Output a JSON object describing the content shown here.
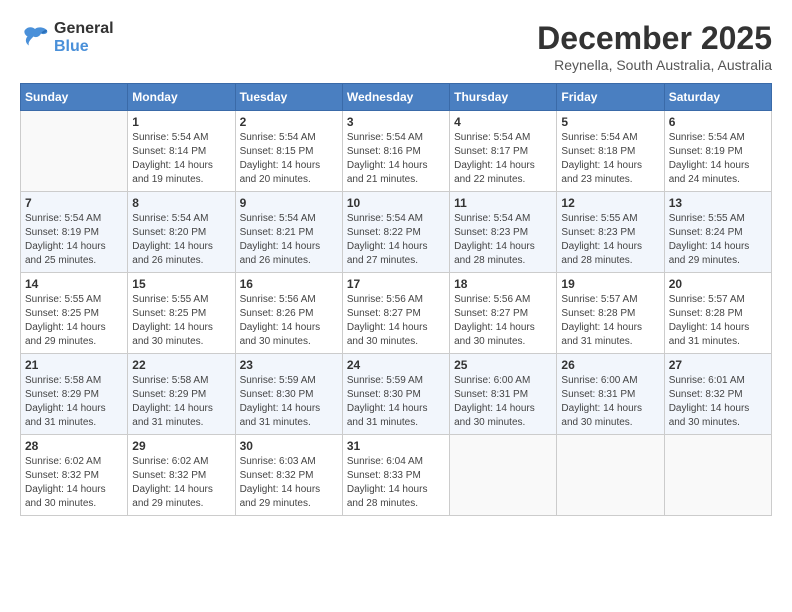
{
  "header": {
    "logo_line1": "General",
    "logo_line2": "Blue",
    "month": "December 2025",
    "location": "Reynella, South Australia, Australia"
  },
  "weekdays": [
    "Sunday",
    "Monday",
    "Tuesday",
    "Wednesday",
    "Thursday",
    "Friday",
    "Saturday"
  ],
  "weeks": [
    [
      {
        "num": "",
        "empty": true
      },
      {
        "num": "1",
        "sunrise": "Sunrise: 5:54 AM",
        "sunset": "Sunset: 8:14 PM",
        "daylight": "Daylight: 14 hours and 19 minutes."
      },
      {
        "num": "2",
        "sunrise": "Sunrise: 5:54 AM",
        "sunset": "Sunset: 8:15 PM",
        "daylight": "Daylight: 14 hours and 20 minutes."
      },
      {
        "num": "3",
        "sunrise": "Sunrise: 5:54 AM",
        "sunset": "Sunset: 8:16 PM",
        "daylight": "Daylight: 14 hours and 21 minutes."
      },
      {
        "num": "4",
        "sunrise": "Sunrise: 5:54 AM",
        "sunset": "Sunset: 8:17 PM",
        "daylight": "Daylight: 14 hours and 22 minutes."
      },
      {
        "num": "5",
        "sunrise": "Sunrise: 5:54 AM",
        "sunset": "Sunset: 8:18 PM",
        "daylight": "Daylight: 14 hours and 23 minutes."
      },
      {
        "num": "6",
        "sunrise": "Sunrise: 5:54 AM",
        "sunset": "Sunset: 8:19 PM",
        "daylight": "Daylight: 14 hours and 24 minutes."
      }
    ],
    [
      {
        "num": "7",
        "sunrise": "Sunrise: 5:54 AM",
        "sunset": "Sunset: 8:19 PM",
        "daylight": "Daylight: 14 hours and 25 minutes."
      },
      {
        "num": "8",
        "sunrise": "Sunrise: 5:54 AM",
        "sunset": "Sunset: 8:20 PM",
        "daylight": "Daylight: 14 hours and 26 minutes."
      },
      {
        "num": "9",
        "sunrise": "Sunrise: 5:54 AM",
        "sunset": "Sunset: 8:21 PM",
        "daylight": "Daylight: 14 hours and 26 minutes."
      },
      {
        "num": "10",
        "sunrise": "Sunrise: 5:54 AM",
        "sunset": "Sunset: 8:22 PM",
        "daylight": "Daylight: 14 hours and 27 minutes."
      },
      {
        "num": "11",
        "sunrise": "Sunrise: 5:54 AM",
        "sunset": "Sunset: 8:23 PM",
        "daylight": "Daylight: 14 hours and 28 minutes."
      },
      {
        "num": "12",
        "sunrise": "Sunrise: 5:55 AM",
        "sunset": "Sunset: 8:23 PM",
        "daylight": "Daylight: 14 hours and 28 minutes."
      },
      {
        "num": "13",
        "sunrise": "Sunrise: 5:55 AM",
        "sunset": "Sunset: 8:24 PM",
        "daylight": "Daylight: 14 hours and 29 minutes."
      }
    ],
    [
      {
        "num": "14",
        "sunrise": "Sunrise: 5:55 AM",
        "sunset": "Sunset: 8:25 PM",
        "daylight": "Daylight: 14 hours and 29 minutes."
      },
      {
        "num": "15",
        "sunrise": "Sunrise: 5:55 AM",
        "sunset": "Sunset: 8:25 PM",
        "daylight": "Daylight: 14 hours and 30 minutes."
      },
      {
        "num": "16",
        "sunrise": "Sunrise: 5:56 AM",
        "sunset": "Sunset: 8:26 PM",
        "daylight": "Daylight: 14 hours and 30 minutes."
      },
      {
        "num": "17",
        "sunrise": "Sunrise: 5:56 AM",
        "sunset": "Sunset: 8:27 PM",
        "daylight": "Daylight: 14 hours and 30 minutes."
      },
      {
        "num": "18",
        "sunrise": "Sunrise: 5:56 AM",
        "sunset": "Sunset: 8:27 PM",
        "daylight": "Daylight: 14 hours and 30 minutes."
      },
      {
        "num": "19",
        "sunrise": "Sunrise: 5:57 AM",
        "sunset": "Sunset: 8:28 PM",
        "daylight": "Daylight: 14 hours and 31 minutes."
      },
      {
        "num": "20",
        "sunrise": "Sunrise: 5:57 AM",
        "sunset": "Sunset: 8:28 PM",
        "daylight": "Daylight: 14 hours and 31 minutes."
      }
    ],
    [
      {
        "num": "21",
        "sunrise": "Sunrise: 5:58 AM",
        "sunset": "Sunset: 8:29 PM",
        "daylight": "Daylight: 14 hours and 31 minutes."
      },
      {
        "num": "22",
        "sunrise": "Sunrise: 5:58 AM",
        "sunset": "Sunset: 8:29 PM",
        "daylight": "Daylight: 14 hours and 31 minutes."
      },
      {
        "num": "23",
        "sunrise": "Sunrise: 5:59 AM",
        "sunset": "Sunset: 8:30 PM",
        "daylight": "Daylight: 14 hours and 31 minutes."
      },
      {
        "num": "24",
        "sunrise": "Sunrise: 5:59 AM",
        "sunset": "Sunset: 8:30 PM",
        "daylight": "Daylight: 14 hours and 31 minutes."
      },
      {
        "num": "25",
        "sunrise": "Sunrise: 6:00 AM",
        "sunset": "Sunset: 8:31 PM",
        "daylight": "Daylight: 14 hours and 30 minutes."
      },
      {
        "num": "26",
        "sunrise": "Sunrise: 6:00 AM",
        "sunset": "Sunset: 8:31 PM",
        "daylight": "Daylight: 14 hours and 30 minutes."
      },
      {
        "num": "27",
        "sunrise": "Sunrise: 6:01 AM",
        "sunset": "Sunset: 8:32 PM",
        "daylight": "Daylight: 14 hours and 30 minutes."
      }
    ],
    [
      {
        "num": "28",
        "sunrise": "Sunrise: 6:02 AM",
        "sunset": "Sunset: 8:32 PM",
        "daylight": "Daylight: 14 hours and 30 minutes."
      },
      {
        "num": "29",
        "sunrise": "Sunrise: 6:02 AM",
        "sunset": "Sunset: 8:32 PM",
        "daylight": "Daylight: 14 hours and 29 minutes."
      },
      {
        "num": "30",
        "sunrise": "Sunrise: 6:03 AM",
        "sunset": "Sunset: 8:32 PM",
        "daylight": "Daylight: 14 hours and 29 minutes."
      },
      {
        "num": "31",
        "sunrise": "Sunrise: 6:04 AM",
        "sunset": "Sunset: 8:33 PM",
        "daylight": "Daylight: 14 hours and 28 minutes."
      },
      {
        "num": "",
        "empty": true
      },
      {
        "num": "",
        "empty": true
      },
      {
        "num": "",
        "empty": true
      }
    ]
  ]
}
